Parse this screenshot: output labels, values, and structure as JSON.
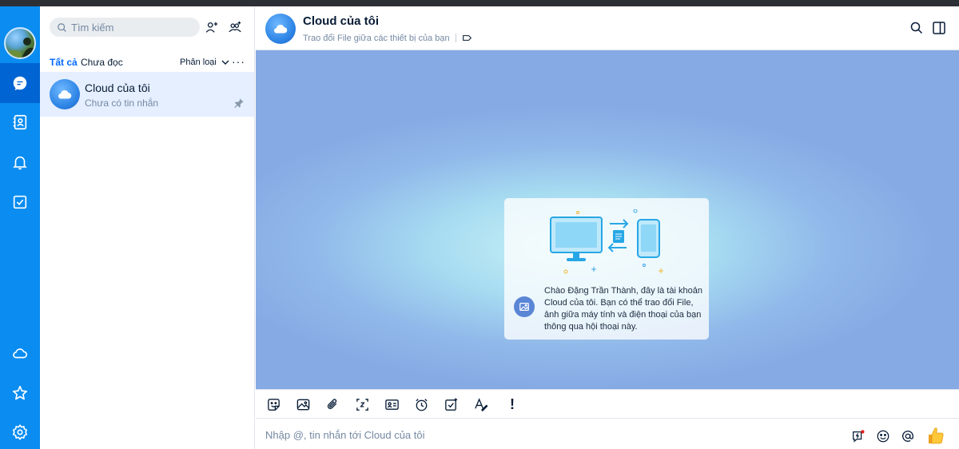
{
  "search": {
    "placeholder": "Tìm kiếm"
  },
  "list": {
    "tabs": [
      {
        "label": "Tất cả",
        "active": true
      },
      {
        "label": "Chưa đọc",
        "active": false
      }
    ],
    "classify_label": "Phân loại",
    "conversations": [
      {
        "name": "Cloud của tôi",
        "preview": "Chưa có tin nhắn",
        "pinned": true
      }
    ]
  },
  "chat": {
    "title": "Cloud của tôi",
    "subtitle": "Trao đổi File giữa các thiết bị của bạn",
    "welcome_message": "Chào Đặng Trần Thành, đây là tài khoản Cloud của tôi. Bạn có thể trao đổi File, ảnh giữa máy tính và điện thoại của bạn thông qua hội thoại này.",
    "toolbar_urgent": "!"
  },
  "composer": {
    "placeholder": "Nhập @, tin nhắn tới Cloud của tôi"
  },
  "colors": {
    "rail": "#0a8cf0",
    "rail_active": "#0064d2",
    "accent": "#0068ff",
    "selected_conversation": "#e5efff",
    "notification_dot": "#e02020"
  },
  "icons": {
    "rail": [
      "avatar",
      "chat-icon",
      "contacts-icon",
      "bell-icon",
      "todo-icon",
      "cloud-icon",
      "star-icon",
      "settings-icon"
    ],
    "toolbar": [
      "sticker-icon",
      "image-icon",
      "attachment-icon",
      "screenshot-icon",
      "contact-card-icon",
      "reminder-icon",
      "task-icon",
      "format-text-icon",
      "urgent-icon"
    ],
    "composer": [
      "quick-message-icon",
      "emoji-icon",
      "mention-icon",
      "thumbs-up-icon"
    ]
  }
}
